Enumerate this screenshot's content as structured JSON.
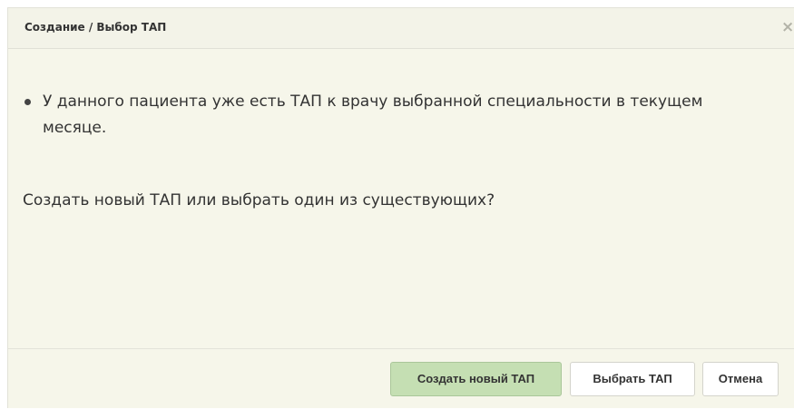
{
  "dialog": {
    "title": "Создание / Выбор ТАП",
    "close_label": "×",
    "messages": [
      "У данного пациента уже есть ТАП к врачу выбранной специальности в текущем месяце."
    ],
    "question": "Создать новый ТАП или выбрать один из существующих?",
    "buttons": {
      "create_label": "Создать новый ТАП",
      "select_label": "Выбрать ТАП",
      "cancel_label": "Отмена"
    }
  },
  "colors": {
    "dialog_background": "#f6f6ea",
    "primary_button": "#c5dfb3",
    "text": "#333333"
  },
  "icons": {
    "close": "close-icon",
    "bullet": "bullet-icon"
  }
}
